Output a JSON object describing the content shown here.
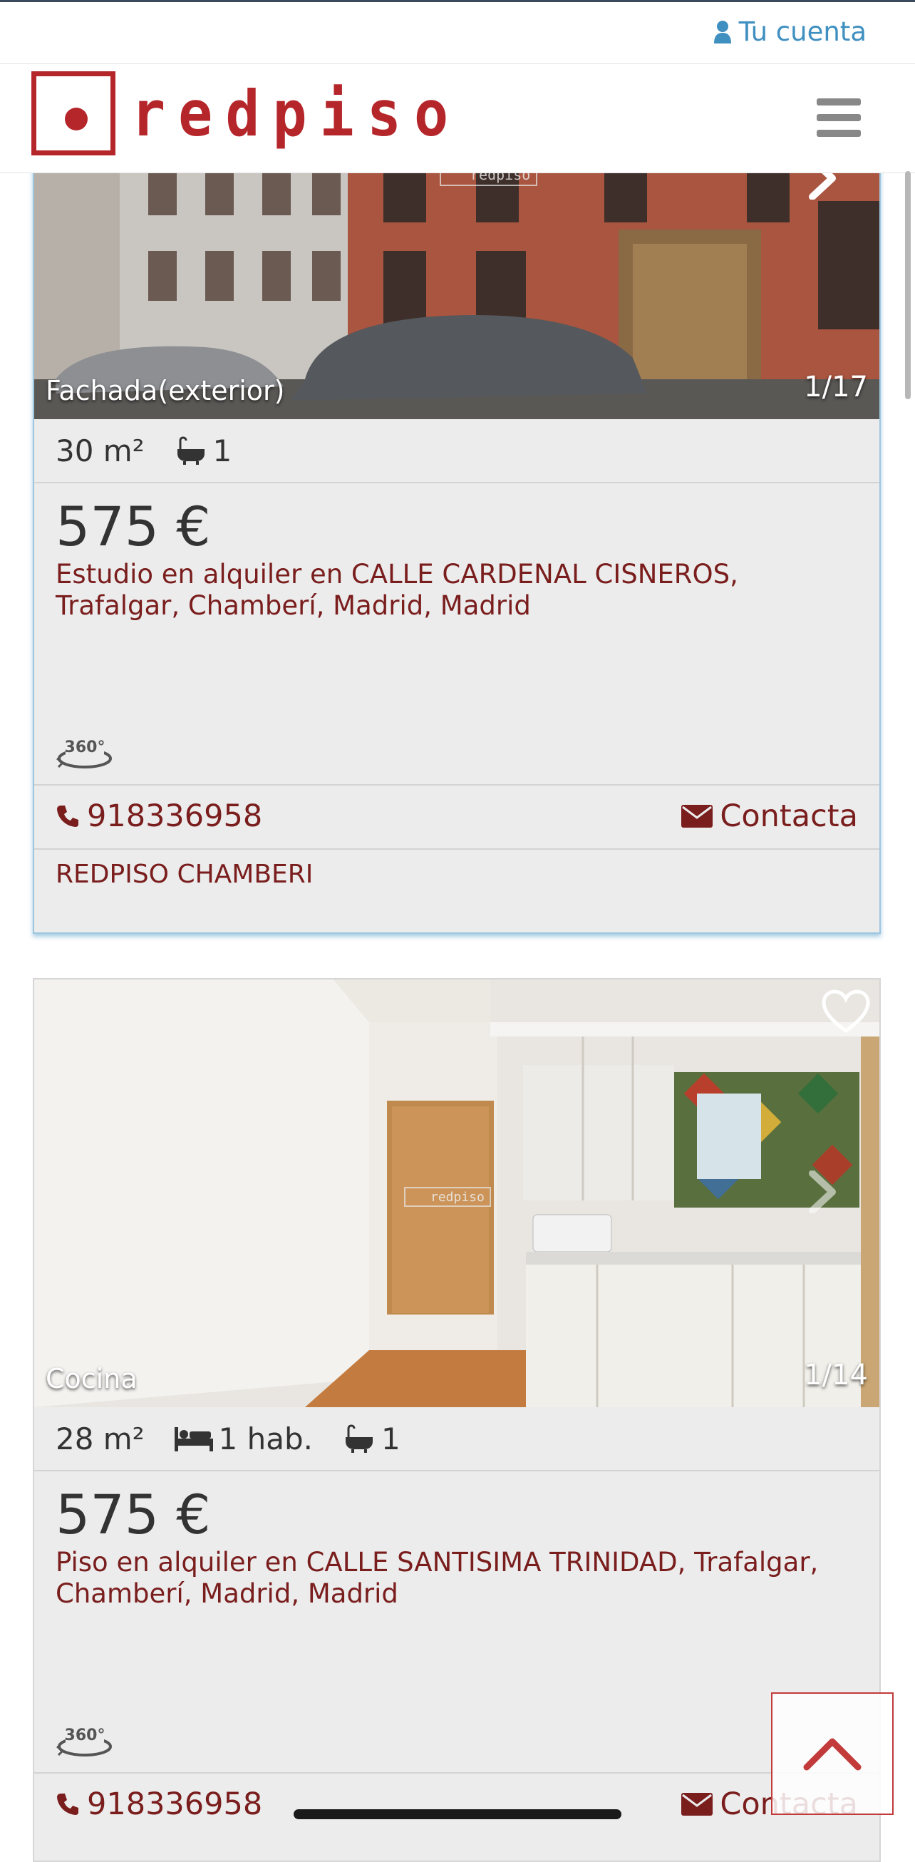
{
  "topbar": {
    "account_label": "Tu cuenta"
  },
  "header": {
    "brand": "redpiso"
  },
  "listings": [
    {
      "photo_caption": "Fachada(exterior)",
      "photo_counter": "1/17",
      "area": "30 m²",
      "baths": "1",
      "price": "575 €",
      "description": "Estudio en alquiler en CALLE CARDENAL CISNEROS, Trafalgar, Chamberí, Madrid, Madrid",
      "pano_label": "360°",
      "phone": "918336958",
      "contact_label": "Contacta",
      "agency": "REDPISO CHAMBERI"
    },
    {
      "photo_caption": "Cocina",
      "photo_counter": "1/14",
      "area": "28 m²",
      "rooms": "1 hab.",
      "baths": "1",
      "price": "575 €",
      "description": "Piso en alquiler en CALLE SANTISIMA TRINIDAD, Trafalgar, Chamberí, Madrid, Madrid",
      "pano_label": "360°",
      "phone": "918336958",
      "contact_label": "Contacta"
    }
  ],
  "colors": {
    "brand_red": "#b5262b",
    "link_blue": "#3f8fc0",
    "text_dark_red": "#7a1d1d",
    "card_bg": "#ececec"
  }
}
